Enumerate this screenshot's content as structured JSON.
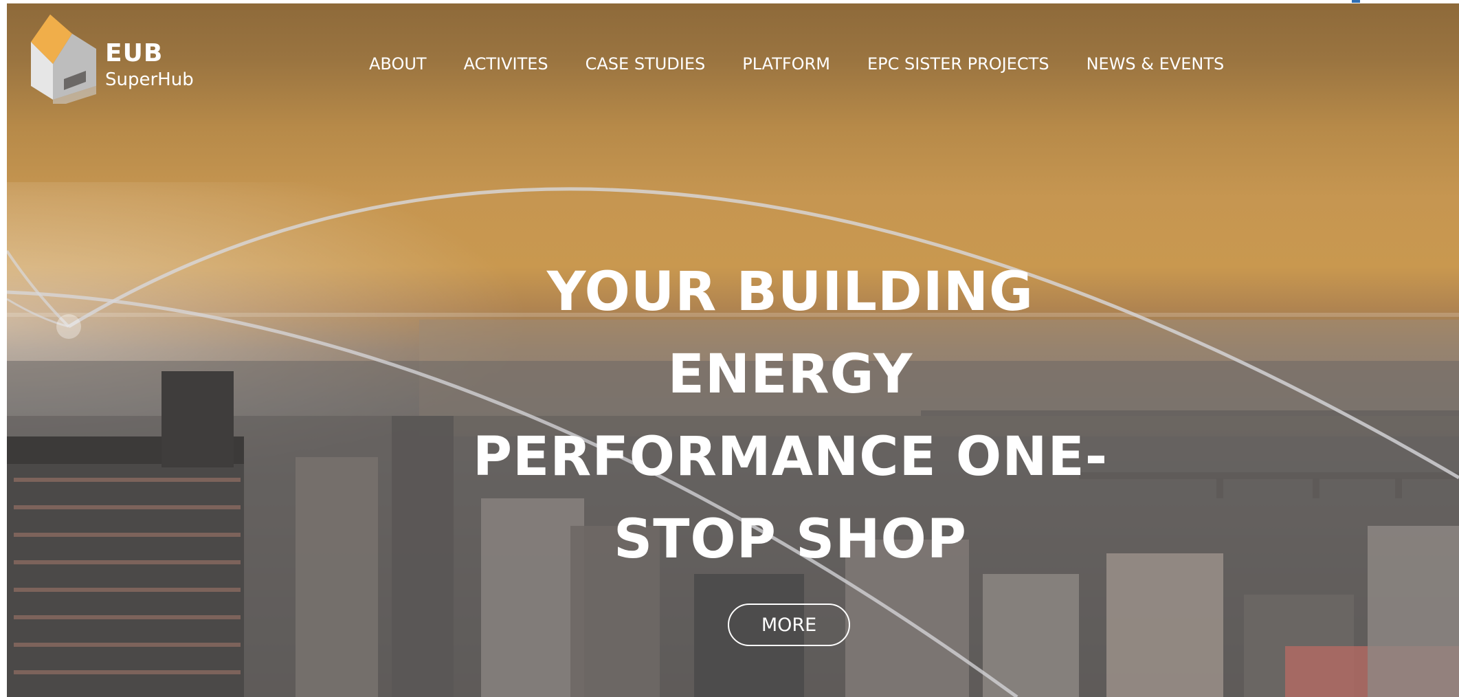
{
  "brand": {
    "name": "EUB",
    "subtitle": "SuperHub",
    "accent_color": "#f0ae4a"
  },
  "nav": {
    "items": [
      {
        "label": "ABOUT"
      },
      {
        "label": "ACTIVITES"
      },
      {
        "label": "CASE STUDIES"
      },
      {
        "label": "PLATFORM"
      },
      {
        "label": "EPC SISTER PROJECTS"
      },
      {
        "label": "NEWS & EVENTS"
      }
    ]
  },
  "hero": {
    "headline_lines": [
      "YOUR BUILDING",
      "ENERGY",
      "PERFORMANCE ONE-",
      "STOP SHOP"
    ],
    "cta_label": "MORE",
    "background_icon": "city-skyline-sunset-image"
  }
}
